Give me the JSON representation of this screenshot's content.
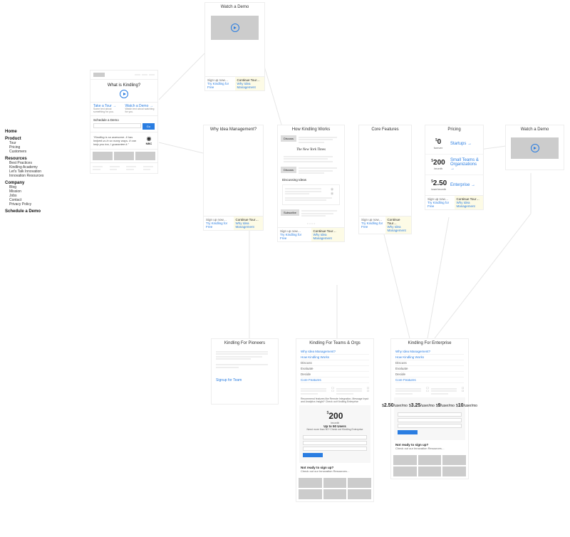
{
  "nav": {
    "home": "Home",
    "product": "Product",
    "product_items": [
      "Tour",
      "Pricing",
      "Customers"
    ],
    "resources": "Resources",
    "resources_items": [
      "Best Practices",
      "Kindling Academy",
      "Let's Talk Innovation",
      "Innovation Resources"
    ],
    "company": "Company",
    "company_items": [
      "Blog",
      "Mission",
      "Jobs",
      "Contact",
      "Privacy Policy"
    ],
    "schedule": "Schedule a Demo"
  },
  "demo_top": {
    "title": "Watch a Demo"
  },
  "demo_right": {
    "title": "Watch a Demo"
  },
  "homecard": {
    "heading": "What is Kindling?",
    "take_tour": "Take a Tour",
    "take_tour_sub": "Some text about something for you.",
    "watch_demo": "Watch a Demo",
    "watch_demo_sub": "Watch text about watching for you.",
    "schedule": "Schedule a Demo",
    "go": "Go",
    "quote": "\"Kindling is so awesome. It has helped us in so many ways. It can help you too, I guarantee it.\"",
    "quote_attr": "NBC"
  },
  "why": {
    "title": "Why Idea Management?"
  },
  "how": {
    "title": "How Kindling Works",
    "chip1": "Discuss",
    "newspaper": "The New York Times",
    "chip2": "Discuss",
    "sub2": "Discussing Ideas",
    "chip3": "Subscribe"
  },
  "core": {
    "title": "Core Features"
  },
  "pricing": {
    "title": "Pricing",
    "p1_num": "0",
    "p1_per": "forever",
    "p2_num": "200",
    "p2_per": "/month",
    "p3_num": "2.50",
    "p3_per": "/user/month",
    "startups": "Startups",
    "teams": "Small Teams & Organizations",
    "enterprise": "Enterprise"
  },
  "footer": {
    "signup": "Sign up now…",
    "try_free": "Try Kindling for Free",
    "continue": "Continue Tour…",
    "why_link": "Why Idea Management"
  },
  "pioneers": {
    "title": "Kindling For Pioneers",
    "signup": "Signup for Team"
  },
  "teams": {
    "title": "Kindling For Teams & Orgs",
    "link_why": "Why Idea Management?",
    "link_how": "How Kindling Works",
    "discuss": "Discuss",
    "evaluate": "Evaluate",
    "decide": "Decide",
    "link_core": "Core Features",
    "recommend": "Recommend features like Remote Integration, Message Input and Analytics Insight? Check out Kindling Enterprise",
    "price_num": "200",
    "price_per": "/month",
    "price_sub": "Up to 50 Users",
    "price_note": "Need more than 50? Check out Kindling Enterprise",
    "not_ready": "Not ready to sign up?",
    "not_ready2": "Check out our Innovation Resources…"
  },
  "enterprise": {
    "title": "Kindling For Enterprise",
    "link_why": "Why Idea Management?",
    "link_how": "How Kindling Works",
    "discuss": "Discuss",
    "evaluate": "Evaluate",
    "decide": "Decide",
    "link_core": "Core Features",
    "t1_num": "2.50",
    "t1_per": "/user/mo",
    "t2_num": "3.25",
    "t2_per": "/user/mo",
    "t3_num": "9",
    "t3_per": "/user/mo",
    "t4_num": "10",
    "t4_per": "/user/mo",
    "not_ready": "Not ready to sign up?",
    "not_ready2": "Check out our Innovation Resources…"
  }
}
